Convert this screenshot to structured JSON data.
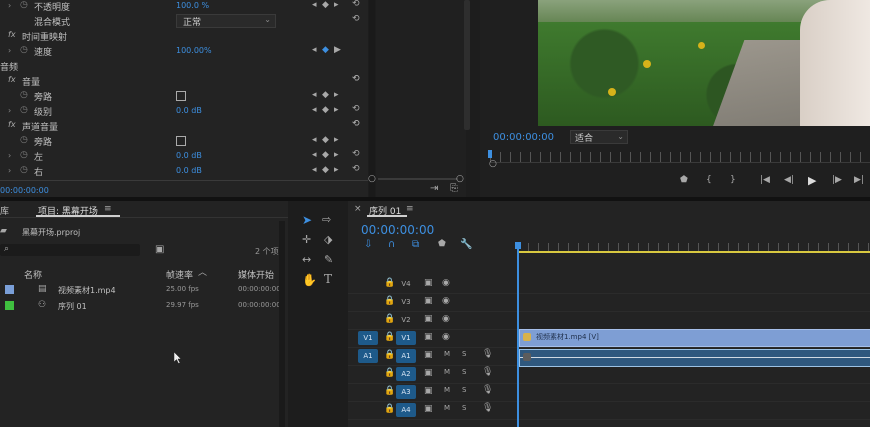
{
  "effects": {
    "rows": [
      {
        "label": "不透明度",
        "value": "100.0 %"
      },
      {
        "label": "混合模式",
        "value": "正常"
      },
      {
        "label": "时间重映射",
        "value": ""
      },
      {
        "label": "速度",
        "value": "100.00%"
      },
      {
        "label": "音频",
        "value": ""
      },
      {
        "label": "音量",
        "value": ""
      },
      {
        "label": "旁路",
        "value": ""
      },
      {
        "label": "级别",
        "value": "0.0 dB"
      },
      {
        "label": "声道音量",
        "value": ""
      },
      {
        "label": "旁路",
        "value": ""
      },
      {
        "label": "左",
        "value": "0.0 dB"
      },
      {
        "label": "右",
        "value": "0.0 dB"
      }
    ],
    "timecode": "00:00:00:00",
    "fx": "fx"
  },
  "program": {
    "timecode": "00:00:00:00",
    "fit": "适合",
    "colors": {
      "accent": "#3d8fe0",
      "green": "#4f8a2c",
      "sky": "#7fa0c0"
    }
  },
  "project": {
    "lib_tab": "库",
    "tab": "项目: 黑幕开场",
    "file": "黑幕开场.prproj",
    "count": "2 个项",
    "columns": {
      "name": "名称",
      "rate": "帧速率",
      "start": "媒体开始"
    },
    "items": [
      {
        "name": "视频素材1.mp4",
        "rate": "25.00 fps",
        "start": "00:00:00:00",
        "color": "#7a9fd8"
      },
      {
        "name": "序列 01",
        "rate": "29.97 fps",
        "start": "00:00:00:00",
        "color": "#3fbf3f"
      }
    ]
  },
  "timeline": {
    "tab": "序列 01",
    "timecode": "00:00:00:00",
    "tracks": [
      {
        "src": "",
        "name": "V4",
        "type": "video"
      },
      {
        "src": "",
        "name": "V3",
        "type": "video"
      },
      {
        "src": "",
        "name": "V2",
        "type": "video"
      },
      {
        "src": "V1",
        "name": "V1",
        "type": "video"
      },
      {
        "src": "A1",
        "name": "A1",
        "type": "audio"
      },
      {
        "src": "",
        "name": "A2",
        "type": "audio"
      },
      {
        "src": "",
        "name": "A3",
        "type": "audio"
      },
      {
        "src": "",
        "name": "A4",
        "type": "audio"
      }
    ],
    "audio_btns": {
      "m": "M",
      "s": "S"
    },
    "clip_label": "视频素材1.mp4 [V]"
  }
}
